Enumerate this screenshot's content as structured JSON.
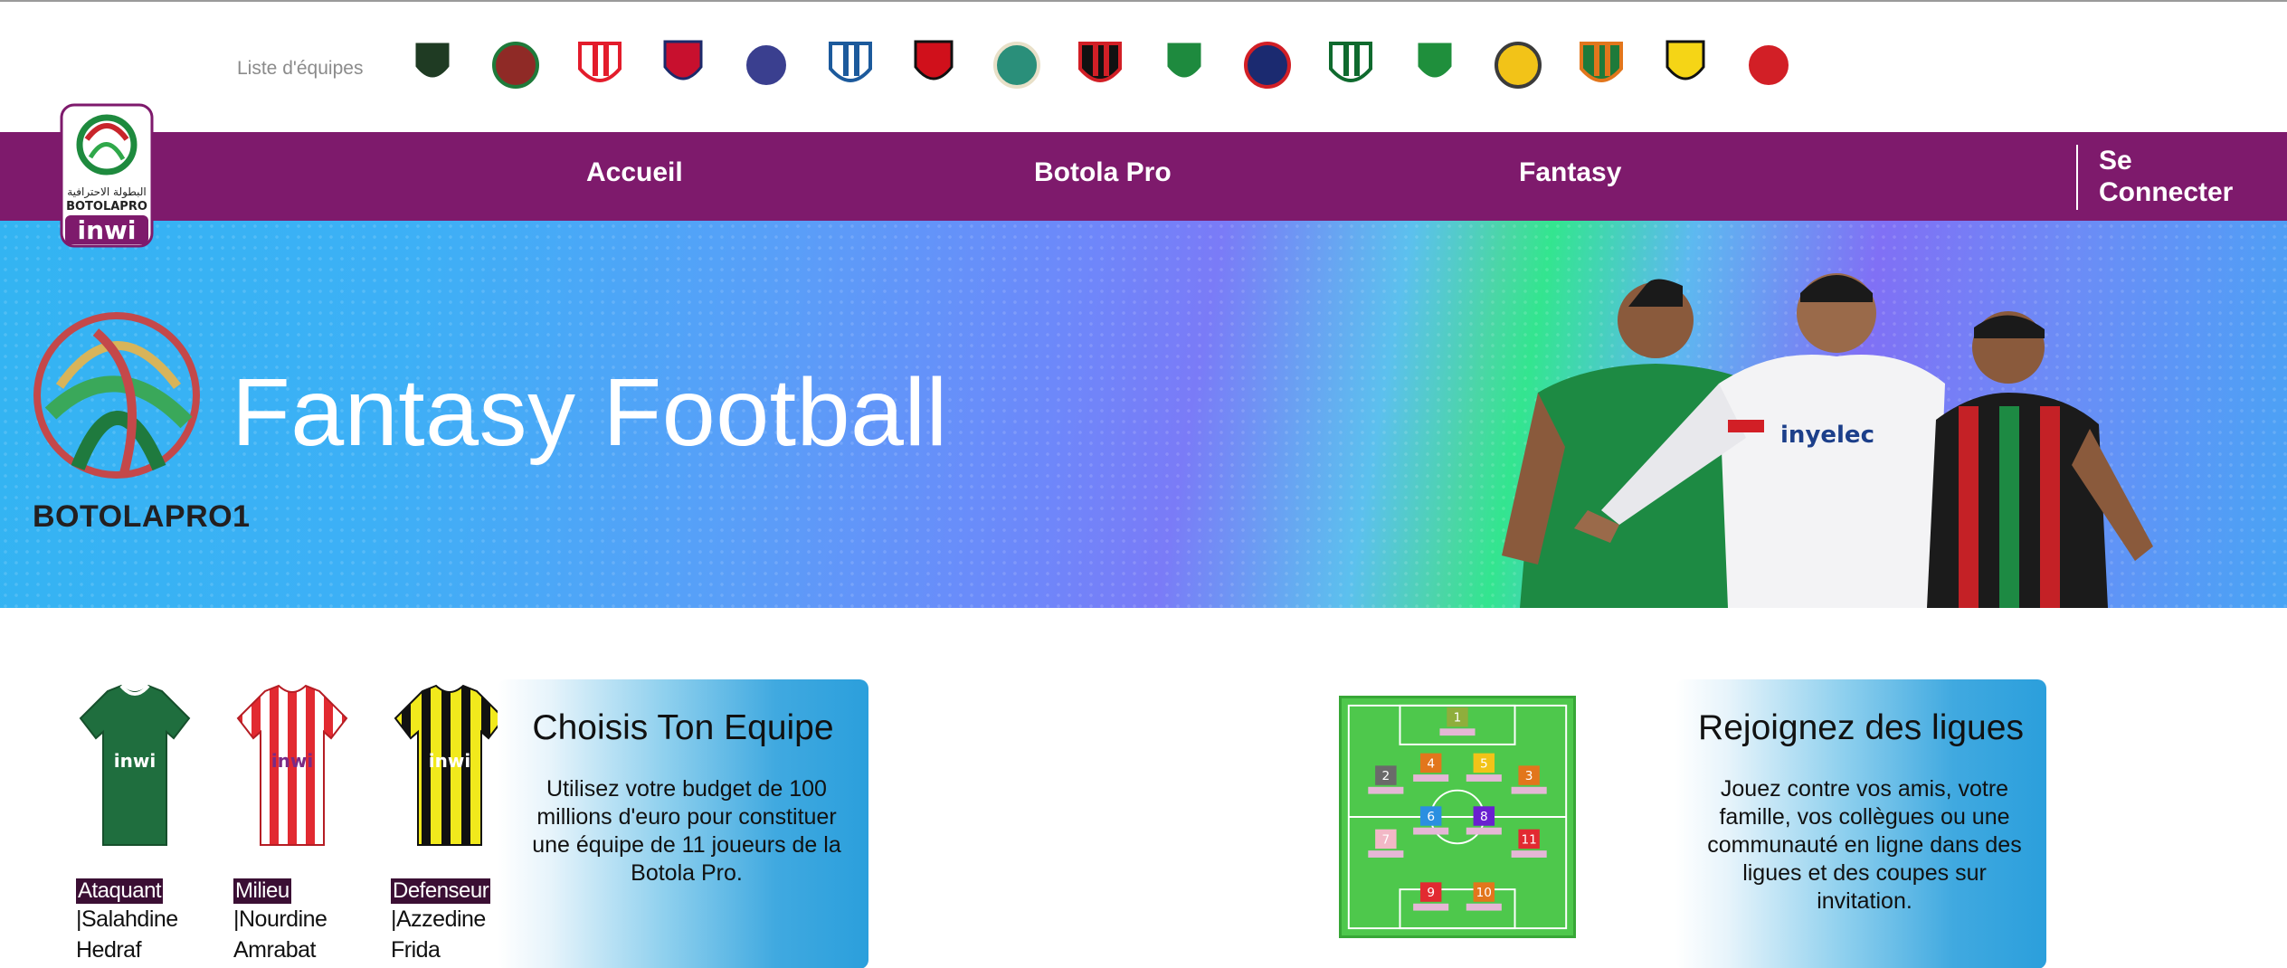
{
  "team_strip": {
    "label": "Liste d'équipes",
    "teams": [
      {
        "icon": "crest-green-black-icon",
        "primary": "#1f3b23",
        "secondary": "#ffffff"
      },
      {
        "icon": "crest-far-icon",
        "primary": "#8f2a26",
        "secondary": "#1e7a3a"
      },
      {
        "icon": "crest-red-white-icon",
        "primary": "#e31c2b",
        "secondary": "#ffffff"
      },
      {
        "icon": "crest-striped-shield-icon",
        "primary": "#c8102e",
        "secondary": "#1c2a6b"
      },
      {
        "icon": "crest-blue-white-icon",
        "primary": "#3a3f8f",
        "secondary": "#ffffff"
      },
      {
        "icon": "crest-blue-badge-icon",
        "primary": "#1c5a9c",
        "secondary": "#ffffff"
      },
      {
        "icon": "crest-fus-icon",
        "primary": "#d0101b",
        "secondary": "#111111"
      },
      {
        "icon": "crest-round-teal-icon",
        "primary": "#2a8f7a",
        "secondary": "#e8e0c8"
      },
      {
        "icon": "crest-red-black-ball-icon",
        "primary": "#d21f26",
        "secondary": "#111111"
      },
      {
        "icon": "crest-raja-icon",
        "primary": "#1e8a3e",
        "secondary": "#ffffff"
      },
      {
        "icon": "crest-navy-red-icon",
        "primary": "#1b2a70",
        "secondary": "#d21f26"
      },
      {
        "icon": "crest-ock-icon",
        "primary": "#0f6a2e",
        "secondary": "#ffffff"
      },
      {
        "icon": "crest-green-star-icon",
        "primary": "#1f8f3c",
        "secondary": "#ffffff"
      },
      {
        "icon": "crest-yellow-shield-icon",
        "primary": "#f2c318",
        "secondary": "#3b3b3b"
      },
      {
        "icon": "crest-round-orange-icon",
        "primary": "#e2761c",
        "secondary": "#1e7a3a"
      },
      {
        "icon": "crest-yellow-black-icon",
        "primary": "#f5d516",
        "secondary": "#111111"
      },
      {
        "icon": "crest-wac-icon",
        "primary": "#d21f26",
        "secondary": "#ffffff"
      }
    ]
  },
  "nav": {
    "links": [
      "Accueil",
      "Botola Pro",
      "Fantasy"
    ],
    "login": "Se Connecter",
    "bg": "#7e1a6c"
  },
  "league_logo": {
    "arabic_text": "البطولة الاحترافية",
    "name": "BOTOLAPRO",
    "sponsor": "inwi"
  },
  "hero": {
    "title": "Fantasy Football",
    "brand": "BOTOLAPRO1"
  },
  "kits": [
    {
      "position": "Ataquant",
      "player": "|Salahdine\nHedraf",
      "jersey": "green"
    },
    {
      "position": "Milieu",
      "player": "|Nourdine\nAmrabat",
      "jersey": "red-white-stripes"
    },
    {
      "position": "Defenseur",
      "player": "|Azzedine\nFrida",
      "jersey": "yellow-black-stripes"
    }
  ],
  "card_team": {
    "title": "Choisis Ton Equipe",
    "text": "Utilisez votre budget de 100 millions d'euro pour constituer une équipe de 11 joueurs de la Botola Pro."
  },
  "card_leagues": {
    "title": "Rejoignez des ligues",
    "text": "Jouez contre vos amis, votre famille, vos collègues ou une communauté en ligne dans des ligues et des coupes sur invitation."
  },
  "pitch": {
    "numbers": [
      "1",
      "2",
      "3",
      "4",
      "5",
      "6",
      "8",
      "7",
      "11",
      "9",
      "10"
    ]
  }
}
